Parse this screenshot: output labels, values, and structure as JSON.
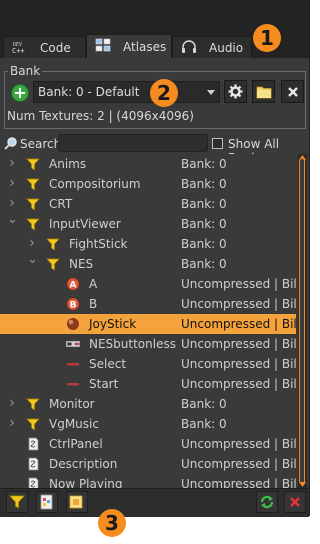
{
  "tabs": [
    {
      "label": "Code",
      "icon": "code-icon"
    },
    {
      "label": "Atlases",
      "icon": "atlases-icon"
    },
    {
      "label": "Audio",
      "icon": "headphones-icon"
    }
  ],
  "callouts": [
    "1",
    "2",
    "3"
  ],
  "bank": {
    "title": "Bank",
    "selected": "Bank: 0 - Default",
    "num_textures": "Num Textures: 2 | (4096x4096)"
  },
  "search": {
    "label": "Search",
    "value": "",
    "show_all_label": "Show All Banks",
    "show_all_checked": false
  },
  "tree": [
    {
      "name": "Anims",
      "info": "Bank: 0",
      "icon": "folder-filter-icon",
      "expander": "collapsed",
      "level": 0
    },
    {
      "name": "Compositorium",
      "info": "Bank: 0",
      "icon": "folder-filter-icon",
      "expander": "collapsed",
      "level": 0
    },
    {
      "name": "CRT",
      "info": "Bank: 0",
      "icon": "folder-filter-icon",
      "expander": "collapsed",
      "level": 0
    },
    {
      "name": "InputViewer",
      "info": "Bank: 0",
      "icon": "folder-filter-icon",
      "expander": "expanded",
      "level": 0
    },
    {
      "name": "FightStick",
      "info": "Bank: 0",
      "icon": "folder-filter-icon",
      "expander": "collapsed",
      "level": 1
    },
    {
      "name": "NES",
      "info": "Bank: 0",
      "icon": "folder-filter-icon",
      "expander": "expanded",
      "level": 1
    },
    {
      "name": "A",
      "info": "Uncompressed | Bili...",
      "icon": "a-button-icon",
      "expander": "none",
      "level": 2
    },
    {
      "name": "B",
      "info": "Uncompressed | Bili...",
      "icon": "b-button-icon",
      "expander": "none",
      "level": 2
    },
    {
      "name": "JoyStick",
      "info": "Uncompressed | Bili...",
      "icon": "joystick-ball-icon",
      "expander": "none",
      "level": 2,
      "selected": true
    },
    {
      "name": "NESbuttonless",
      "info": "Uncompressed | Bili...",
      "icon": "nes-controller-icon",
      "expander": "none",
      "level": 2
    },
    {
      "name": "Select",
      "info": "Uncompressed | Bili...",
      "icon": "red-bar-icon",
      "expander": "none",
      "level": 2
    },
    {
      "name": "Start",
      "info": "Uncompressed | Bili...",
      "icon": "red-bar-icon",
      "expander": "none",
      "level": 2
    },
    {
      "name": "Monitor",
      "info": "Bank: 0",
      "icon": "folder-filter-icon",
      "expander": "collapsed",
      "level": 0
    },
    {
      "name": "VgMusic",
      "info": "Bank: 0",
      "icon": "folder-filter-icon",
      "expander": "collapsed",
      "level": 0
    },
    {
      "name": "CtrlPanel",
      "info": "Uncompressed | Bili...",
      "icon": "document-icon",
      "expander": "none",
      "level": 0
    },
    {
      "name": "Description",
      "info": "Uncompressed | Bili...",
      "icon": "document-icon",
      "expander": "none",
      "level": 0
    },
    {
      "name": "Now Playing",
      "info": "Uncompressed | Bili...",
      "icon": "document-icon",
      "expander": "none",
      "level": 0
    }
  ],
  "colors": {
    "accent": "#f68b1f",
    "selection": "#f3a23c",
    "panel": "#3a3a3a",
    "folder": "#f2c81b"
  }
}
